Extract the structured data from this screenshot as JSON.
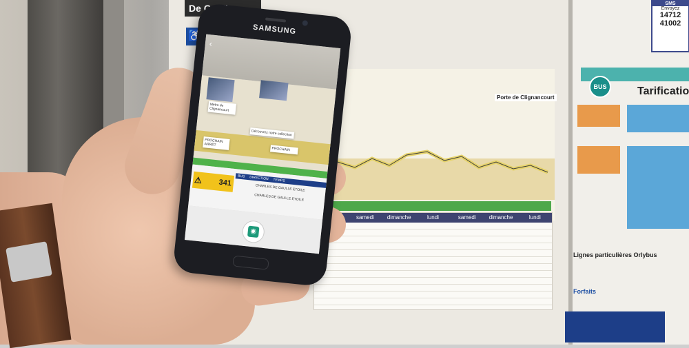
{
  "scene": {
    "stop_name": "De Gaulle",
    "terminus": "Porte de Clignancourt",
    "bus_label": "BUS",
    "tarif_title": "Tarificatio",
    "lines_title": "Lignes particulières Orlybus",
    "forfaits_title": "Forfaits",
    "sms_box": {
      "title": "SMS",
      "label": "Envoyez",
      "code1": "14712",
      "code2": "41002"
    },
    "schedule_headers": [
      "",
      "samedi",
      "dimanche",
      "lundi",
      "samedi",
      "dimanche",
      "lundi"
    ]
  },
  "phone": {
    "brand": "SAMSUNG",
    "back_icon": "back-arrow-icon",
    "ar_cards": [
      {
        "id": "card1",
        "text": "Métro de Clignancourt"
      },
      {
        "id": "card2",
        "text": "Découvrez notre collection"
      },
      {
        "id": "card3",
        "text": "PROCHAIN ARRÊT"
      },
      {
        "id": "card4",
        "text": "PROCHAIN"
      }
    ],
    "next_bus": {
      "line": "341",
      "warning_icon": "warning-icon"
    },
    "bus_table": {
      "headers": [
        "BUS",
        "DIRECTION",
        "TEMPS"
      ],
      "rows": [
        {
          "direction": "CHARLES DE GAULLE ETOILE"
        },
        {
          "direction": "CHARLES DE GAULLE ETOILE"
        }
      ]
    },
    "shutter_icon": "camera-icon"
  },
  "colors": {
    "accent_teal": "#4cb2ad",
    "route_yellow": "#e6d36a",
    "schedule_navy": "#3e4470",
    "warning_yellow": "#f1c21b",
    "shutter_green": "#1d9a7a"
  }
}
